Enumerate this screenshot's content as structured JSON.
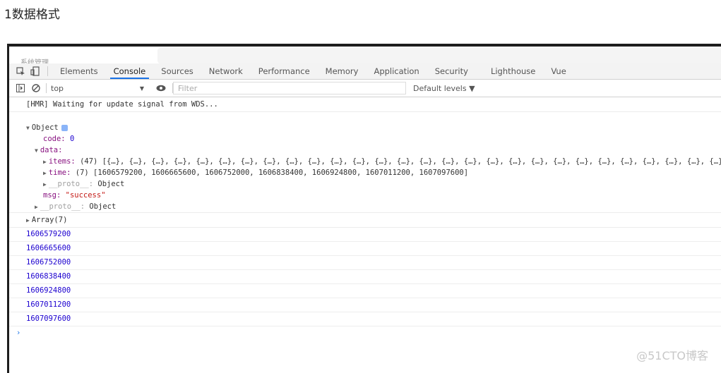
{
  "page_heading": "1数据格式",
  "window": {
    "crumb": "系统管理"
  },
  "tabs": [
    "Elements",
    "Console",
    "Sources",
    "Network",
    "Performance",
    "Memory",
    "Application",
    "Security",
    "Lighthouse",
    "Vue"
  ],
  "active_tab": "Console",
  "toolbar": {
    "context": "top",
    "filter_placeholder": "Filter",
    "levels": "Default levels ▼"
  },
  "console": {
    "hmr": "[HMR] Waiting for update signal from WDS...",
    "object_label": "Object",
    "code_key": "code:",
    "code_val": "0",
    "data_key": "data:",
    "items_key": "items:",
    "items_val": "(47) [{…}, {…}, {…}, {…}, {…}, {…}, {…}, {…}, {…}, {…}, {…}, {…}, {…}, {…}, {…}, {…}, {…}, {…}, {…}, {…}, {…}, {…}, {…}, {…}, {…}, {…}, {…}, {…}",
    "time_key": "time:",
    "time_val": "(7) [1606579200, 1606665600, 1606752000, 1606838400, 1606924800, 1607011200, 1607097600]",
    "proto_key": "__proto__:",
    "proto_val": "Object",
    "msg_key": "msg:",
    "msg_val": "\"success\"",
    "array_label": "Array(7)",
    "timestamps": [
      "1606579200",
      "1606665600",
      "1606752000",
      "1606838400",
      "1606924800",
      "1607011200",
      "1607097600"
    ],
    "prompt": "›"
  },
  "watermark": "@51CTO博客"
}
